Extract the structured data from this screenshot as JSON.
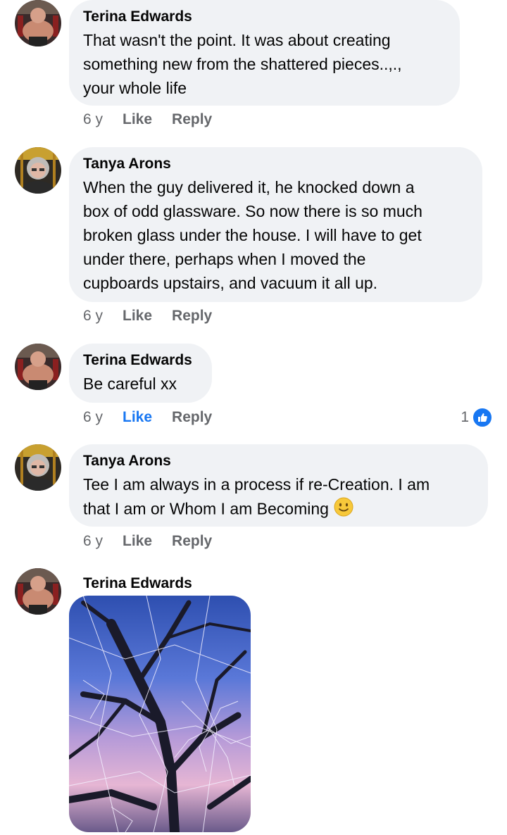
{
  "comments": [
    {
      "author": "Terina Edwards",
      "lines": [
        "That wasn't the point. It was about creating",
        "something new from the shattered pieces..,.,",
        "your whole life"
      ],
      "time": "6 y",
      "like_label": "Like",
      "reply_label": "Reply"
    },
    {
      "author": "Tanya Arons",
      "lines": [
        "When the guy delivered it, he knocked down a",
        "box of odd glassware.  So now there is so much",
        "broken glass under the house.  I will have to get",
        "under there, perhaps when I moved the",
        "cupboards upstairs,  and vacuum it all up."
      ],
      "time": "6 y",
      "like_label": "Like",
      "reply_label": "Reply"
    },
    {
      "author": "Terina Edwards",
      "lines": [
        "Be careful xx"
      ],
      "time": "6 y",
      "like_label": "Like",
      "reply_label": "Reply",
      "reaction_count": "1"
    },
    {
      "author": "Tanya Arons",
      "lines": [
        "Tee I am always in a process if re-Creation.  I am",
        "that I am or Whom I am Becoming"
      ],
      "time": "6 y",
      "like_label": "Like",
      "reply_label": "Reply"
    },
    {
      "author": "Terina Edwards"
    }
  ],
  "colors": {
    "bubble": "#f0f2f5",
    "meta": "#65676b",
    "accent": "#1877f2"
  }
}
